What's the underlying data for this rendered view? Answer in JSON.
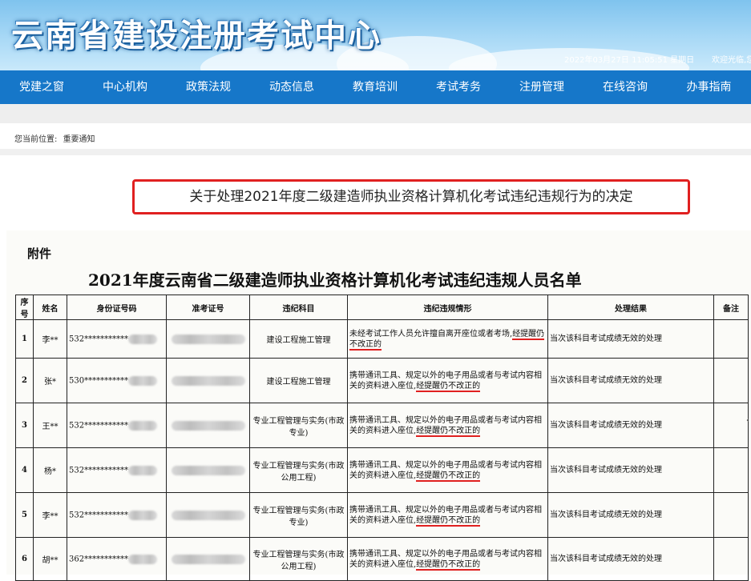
{
  "header": {
    "title": "云南省建设注册考试中心",
    "datetime": "2022年03月27日 11:05:51 星期日",
    "welcome": "欢迎光临,您"
  },
  "nav": [
    {
      "label": "党建之窗"
    },
    {
      "label": "中心机构"
    },
    {
      "label": "政策法规"
    },
    {
      "label": "动态信息"
    },
    {
      "label": "教育培训"
    },
    {
      "label": "考试考务"
    },
    {
      "label": "注册管理"
    },
    {
      "label": "在线咨询"
    },
    {
      "label": "办事指南"
    }
  ],
  "breadcrumb": {
    "prefix": "您当前位置:",
    "current": "重要通知"
  },
  "notice_title": "关于处理2021年度二级建造师执业资格计算机化考试违纪违规行为的决定",
  "document": {
    "attachment": "附件",
    "title": "2021年度云南省二级建造师执业资格计算机化考试违纪违规人员名单",
    "headers": [
      "序号",
      "姓名",
      "身份证号码",
      "准考证号",
      "违纪科目",
      "违纪违规情形",
      "处理结果",
      "备注"
    ],
    "rows": [
      {
        "no": "1",
        "name": "李**",
        "id": "532***********",
        "subject": "建设工程施工管理",
        "situation_a": "未经考试工作人员允许擅自离开座位或者考场,",
        "situation_b": "经提醒仍不改正的",
        "result": "当次该科目考试成绩无效的处理"
      },
      {
        "no": "2",
        "name": "张*",
        "id": "530***********",
        "subject": "建设工程施工管理",
        "situation_a": "携带通讯工具、规定以外的电子用品或者与考试内容相关的资料进入座位,",
        "situation_b": "经提醒仍不改正的",
        "result": "当次该科目考试成绩无效的处理"
      },
      {
        "no": "3",
        "name": "王**",
        "id": "532***********",
        "subject": "专业工程管理与实务(市政专业)",
        "situation_a": "携带通讯工具、规定以外的电子用品或者与考试内容相关的资料进入座位,",
        "situation_b": "经提醒仍不改正的",
        "result": "当次该科目考试成绩无效的处理"
      },
      {
        "no": "4",
        "name": "杨*",
        "id": "532***********",
        "subject": "专业工程管理与实务(市政公用工程)",
        "situation_a": "携带通讯工具、规定以外的电子用品或者与考试内容相关的资料进入座位,",
        "situation_b": "经提醒仍不改正的",
        "result": "当次该科目考试成绩无效的处理"
      },
      {
        "no": "5",
        "name": "李**",
        "id": "532***********",
        "subject": "专业工程管理与实务(市政专业)",
        "situation_a": "携带通讯工具、规定以外的电子用品或者与考试内容相关的资料进入座位,",
        "situation_b": "经提醒仍不改正的",
        "result": "当次该科目考试成绩无效的处理"
      },
      {
        "no": "6",
        "name": "胡**",
        "id": "362***********",
        "subject": "专业工程管理与实务(市政公用工程)",
        "situation_a": "携带通讯工具、规定以外的电子用品或者与考试内容相关的资料进入座位,",
        "situation_b": "经提醒仍不改正的",
        "result": "当次该科目考试成绩无效的处理"
      }
    ]
  },
  "colors": {
    "nav_bg": "#1677c9",
    "highlight": "#e02020"
  }
}
